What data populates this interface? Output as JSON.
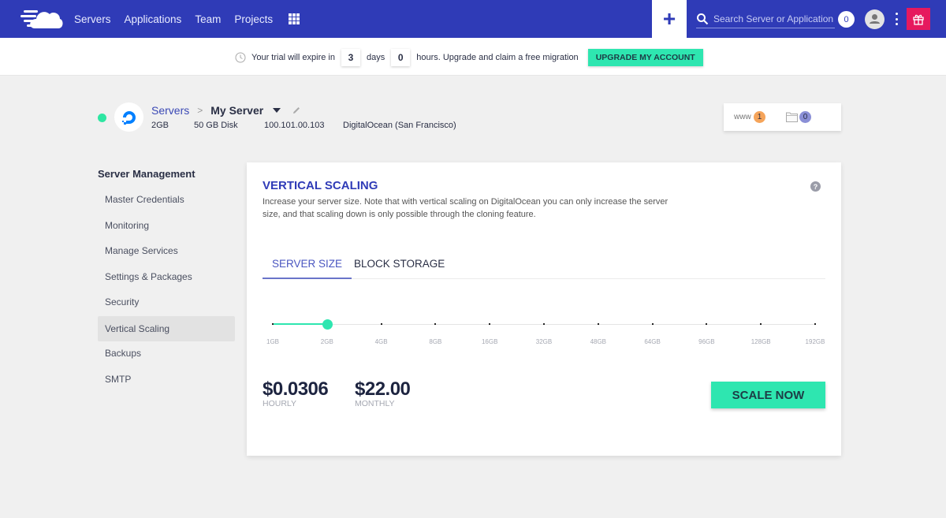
{
  "topnav": {
    "logo_icon": "cloud-logo-icon",
    "links": [
      {
        "label": "Servers"
      },
      {
        "label": "Applications"
      },
      {
        "label": "Team"
      },
      {
        "label": "Projects"
      }
    ],
    "apps_icon": "grid-icon",
    "add_label": "+",
    "search_placeholder": "Search Server or Application",
    "notification_count": "0",
    "avatar_icon": "user-avatar-icon",
    "menu_icon": "kebab-icon",
    "gift_icon": "gift-icon",
    "brand_color": "#2f3bb7"
  },
  "trial": {
    "text_before": "Your trial will expire in",
    "days_value": "3",
    "days_label": "days",
    "hours_value": "0",
    "hours_label": "hours. Upgrade and claim a free migration",
    "upgrade_label": "UPGRADE MY ACCOUNT",
    "accent_color": "#2ee6b0"
  },
  "server": {
    "status": "running",
    "provider_icon": "digitalocean-icon",
    "breadcrumb_parent": "Servers",
    "breadcrumb_sep": ">",
    "name": "My Server",
    "ram": "2GB",
    "disk": "50 GB Disk",
    "ip": "100.101.00.103",
    "location": "DigitalOcean (San Francisco)",
    "www_label": "www",
    "www_count": "1",
    "folder_count": "0"
  },
  "sidebar": {
    "title": "Server Management",
    "items": [
      {
        "label": "Master Credentials",
        "active": false
      },
      {
        "label": "Monitoring",
        "active": false
      },
      {
        "label": "Manage Services",
        "active": false
      },
      {
        "label": "Settings & Packages",
        "active": false
      },
      {
        "label": "Security",
        "active": false
      },
      {
        "label": "Vertical Scaling",
        "active": true
      },
      {
        "label": "Backups",
        "active": false
      },
      {
        "label": "SMTP",
        "active": false
      }
    ]
  },
  "main": {
    "title": "VERTICAL SCALING",
    "description": "Increase your server size. Note that with vertical scaling on DigitalOcean you can only increase the server size, and that scaling down is only possible through the cloning feature.",
    "help_label": "?",
    "tabs": [
      {
        "label": "SERVER SIZE",
        "active": true
      },
      {
        "label": "BLOCK STORAGE",
        "active": false
      }
    ],
    "sizes": [
      "1GB",
      "2GB",
      "4GB",
      "8GB",
      "16GB",
      "32GB",
      "48GB",
      "64GB",
      "96GB",
      "128GB",
      "192GB"
    ],
    "selected_size_index": 1,
    "hourly_price": "$0.0306",
    "hourly_label": "HOURLY",
    "monthly_price": "$22.00",
    "monthly_label": "MONTHLY",
    "scale_label": "SCALE NOW"
  }
}
